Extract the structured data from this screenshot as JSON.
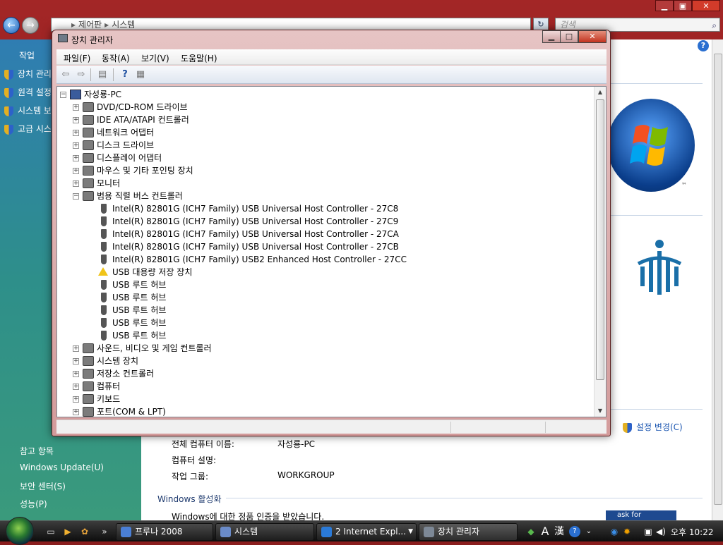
{
  "background_window": {
    "address_parts": [
      "제어판",
      "시스템"
    ],
    "search_placeholder": "검색",
    "tasks_title": "작업",
    "tasks": [
      "장치 관리자",
      "원격 설정",
      "시스템 보호",
      "고급 시스템 설정"
    ],
    "see_also_title": "참고 항목",
    "see_also": [
      "Windows Update(U)",
      "보안 센터(S)",
      "성능(P)"
    ],
    "settings_change": "설정 변경(C)",
    "computer_info": [
      {
        "label": "전체 컴퓨터 이름:",
        "value": "자성룡-PC"
      },
      {
        "label": "컴퓨터 설명:",
        "value": ""
      },
      {
        "label": "작업 그룹:",
        "value": "WORKGROUP"
      }
    ],
    "activation_heading": "Windows 활성화",
    "activation_text": "Windows에 대한 정품 인증을 받았습니다.",
    "ask_for": "ask for"
  },
  "device_manager": {
    "title": "장치 관리자",
    "menu": [
      "파일(F)",
      "동작(A)",
      "보기(V)",
      "도움말(H)"
    ],
    "root": "자성룡-PC",
    "categories_before": [
      {
        "label": "DVD/CD-ROM 드라이브",
        "icon": "disc-drive-icon"
      },
      {
        "label": "IDE ATA/ATAPI 컨트롤러",
        "icon": "ide-controller-icon"
      },
      {
        "label": "네트워크 어댑터",
        "icon": "network-adapter-icon"
      },
      {
        "label": "디스크 드라이브",
        "icon": "disk-drive-icon"
      },
      {
        "label": "디스플레이 어댑터",
        "icon": "display-adapter-icon"
      },
      {
        "label": "마우스 및 기타 포인팅 장치",
        "icon": "mouse-icon"
      },
      {
        "label": "모니터",
        "icon": "monitor-icon"
      }
    ],
    "expanded_category": "범용 직렬 버스 컨트롤러",
    "usb_devices": [
      {
        "label": "Intel(R) 82801G (ICH7 Family) USB Universal Host Controller - 27C8",
        "warning": false
      },
      {
        "label": "Intel(R) 82801G (ICH7 Family) USB Universal Host Controller - 27C9",
        "warning": false
      },
      {
        "label": "Intel(R) 82801G (ICH7 Family) USB Universal Host Controller - 27CA",
        "warning": false
      },
      {
        "label": "Intel(R) 82801G (ICH7 Family) USB Universal Host Controller - 27CB",
        "warning": false
      },
      {
        "label": "Intel(R) 82801G (ICH7 Family) USB2 Enhanced Host Controller - 27CC",
        "warning": false
      },
      {
        "label": "USB 대용량 저장 장치",
        "warning": true
      },
      {
        "label": "USB 루트 허브",
        "warning": false
      },
      {
        "label": "USB 루트 허브",
        "warning": false
      },
      {
        "label": "USB 루트 허브",
        "warning": false
      },
      {
        "label": "USB 루트 허브",
        "warning": false
      },
      {
        "label": "USB 루트 허브",
        "warning": false
      }
    ],
    "categories_after": [
      {
        "label": "사운드, 비디오 및 게임 컨트롤러",
        "icon": "speaker-icon"
      },
      {
        "label": "시스템 장치",
        "icon": "system-device-icon"
      },
      {
        "label": "저장소 컨트롤러",
        "icon": "storage-controller-icon"
      },
      {
        "label": "컴퓨터",
        "icon": "computer-icon"
      },
      {
        "label": "키보드",
        "icon": "keyboard-icon"
      },
      {
        "label": "포트(COM & LPT)",
        "icon": "port-icon"
      }
    ]
  },
  "taskbar": {
    "buttons": [
      {
        "label": "프루나 2008",
        "active": false
      },
      {
        "label": "시스템",
        "active": false
      },
      {
        "label": "2 Internet Expl...",
        "active": false
      },
      {
        "label": "장치 관리자",
        "active": true
      }
    ],
    "ime_a": "A",
    "ime_han": "漢",
    "clock": "오후 10:22"
  }
}
